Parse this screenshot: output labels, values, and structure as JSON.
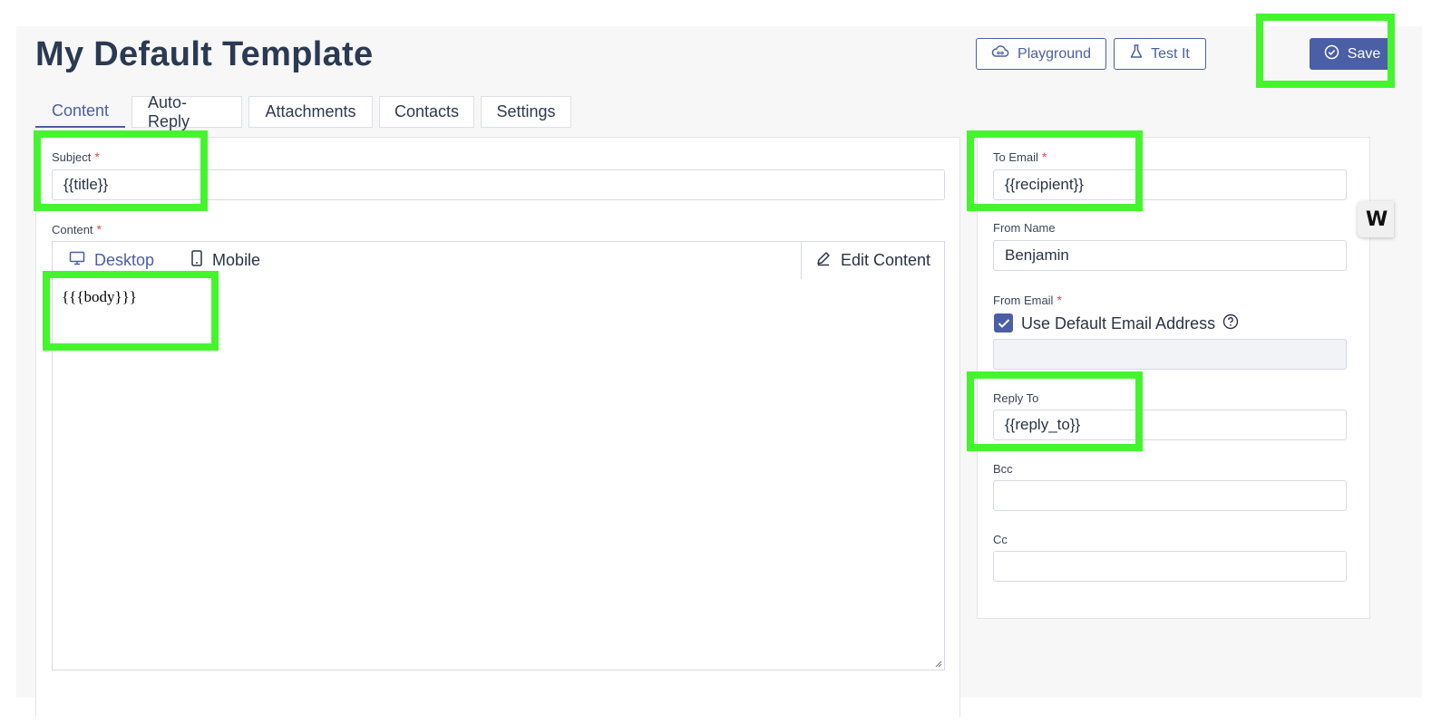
{
  "header": {
    "title": "My Default Template",
    "playground_label": "Playground",
    "test_label": "Test It",
    "save_label": "Save"
  },
  "tabs": [
    {
      "label": "Content",
      "active": true
    },
    {
      "label": "Auto-Reply"
    },
    {
      "label": "Attachments"
    },
    {
      "label": "Contacts"
    },
    {
      "label": "Settings"
    }
  ],
  "content_form": {
    "subject_label": "Subject",
    "subject_value": "{{title}}",
    "content_label": "Content",
    "required_mark": "*",
    "editor_tabs": {
      "desktop": "Desktop",
      "mobile": "Mobile"
    },
    "edit_content_label": "Edit Content",
    "body_value": "{{{body}}}"
  },
  "settings_form": {
    "to_email_label": "To Email",
    "to_email_value": "{{recipient}}",
    "from_name_label": "From Name",
    "from_name_value": "Benjamin",
    "from_email_label": "From Email",
    "use_default_label": "Use Default Email Address",
    "use_default_checked": true,
    "reply_to_label": "Reply To",
    "reply_to_value": "{{reply_to}}",
    "bcc_label": "Bcc",
    "bcc_value": "",
    "cc_label": "Cc",
    "cc_value": ""
  },
  "side_widget": {
    "letter": "W"
  },
  "colors": {
    "accent": "#4a5fa5",
    "highlight": "#44f52e",
    "required": "#e0454b"
  }
}
